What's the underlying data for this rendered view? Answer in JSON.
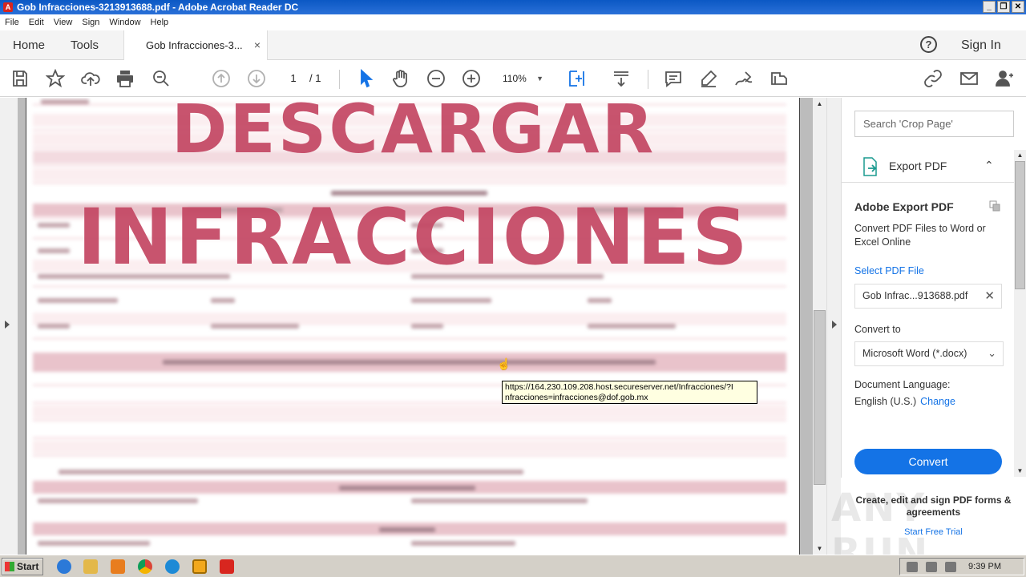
{
  "window": {
    "title": "Gob Infracciones-3213913688.pdf - Adobe Acrobat Reader DC",
    "app_icon": "acrobat-icon",
    "buttons": [
      "_",
      "❐",
      "✕"
    ]
  },
  "menu": [
    "File",
    "Edit",
    "View",
    "Sign",
    "Window",
    "Help"
  ],
  "tabs": {
    "home": "Home",
    "tools": "Tools",
    "document": "Gob Infracciones-3...",
    "close": "×"
  },
  "header": {
    "help_icon": "?",
    "sign_in": "Sign In"
  },
  "toolbar": {
    "page_current": "1",
    "page_total": "/ 1",
    "zoom": "110%",
    "zoom_caret": "▼",
    "icons": [
      "save-icon",
      "bookmark-star-icon",
      "upload-cloud-icon",
      "print-icon",
      "search-zoom-icon",
      "page-up-icon",
      "page-down-icon",
      "select-cursor-icon",
      "hand-icon",
      "zoom-out-icon",
      "zoom-in-icon",
      "fit-page-icon",
      "scroll-mode-icon",
      "comment-icon",
      "highlight-icon",
      "sign-icon",
      "stamp-icon",
      "link-icon",
      "email-icon",
      "add-user-icon"
    ]
  },
  "document": {
    "watermark_line1": "DESCARGAR",
    "watermark_line2": "INFRACCIONES",
    "accent_color": "#c44864"
  },
  "tooltip": {
    "line1": "https://164.230.109.208.host.secureserver.net/Infracciones/?I",
    "line2": "nfracciones=infracciones@dof.gob.mx"
  },
  "panel": {
    "search_placeholder": "Search 'Crop Page'",
    "export_label": "Export PDF",
    "title": "Adobe Export PDF",
    "description": "Convert PDF Files to Word or Excel Online",
    "select_file": "Select PDF File",
    "file_name": "Gob Infrac...913688.pdf",
    "convert_to": "Convert to",
    "format": "Microsoft Word (*.docx)",
    "doc_language_label": "Document Language:",
    "language": "English (U.S.)",
    "change": "Change",
    "convert_button": "Convert",
    "promo_text": "Create, edit and sign PDF forms & agreements",
    "promo_link": "Start Free Trial",
    "watermark": "ANY RUN",
    "accent": "#1473e6"
  },
  "taskbar": {
    "start": "Start",
    "clock": "9:39 PM"
  }
}
